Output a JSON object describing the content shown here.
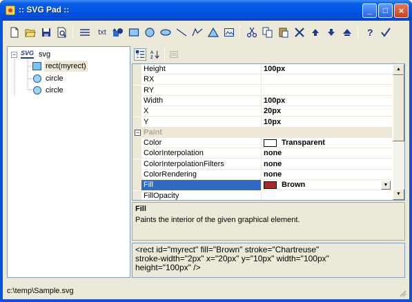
{
  "window": {
    "title": ":: SVG Pad ::",
    "controls": [
      "_",
      "□",
      "×"
    ]
  },
  "toolbar": {
    "items": [
      {
        "name": "new-document-icon"
      },
      {
        "name": "open-folder-icon"
      },
      {
        "name": "save-icon"
      },
      {
        "name": "print-preview-icon"
      },
      {
        "name": "lines-icon"
      },
      {
        "name": "text-tool",
        "label": "txt"
      },
      {
        "name": "shapes-icon"
      },
      {
        "name": "rect-tool-icon"
      },
      {
        "name": "circle-tool-icon"
      },
      {
        "name": "ellipse-tool-icon"
      },
      {
        "name": "line-tool-icon"
      },
      {
        "name": "polyline-tool-icon"
      },
      {
        "name": "polygon-tool-icon"
      },
      {
        "name": "image-tool-icon"
      },
      {
        "name": "cut-icon"
      },
      {
        "name": "copy-icon"
      },
      {
        "name": "paste-icon"
      },
      {
        "name": "delete-icon"
      },
      {
        "name": "move-up-icon"
      },
      {
        "name": "move-down-icon"
      },
      {
        "name": "move-top-icon"
      },
      {
        "name": "help-icon"
      },
      {
        "name": "check-icon"
      }
    ]
  },
  "tree": {
    "root_tag": "SVG",
    "root_label": "svg",
    "children": [
      {
        "label": "rect(myrect)",
        "kind": "rect"
      },
      {
        "label": "circle",
        "kind": "circle"
      },
      {
        "label": "circle",
        "kind": "circle"
      }
    ]
  },
  "properties": {
    "rows": [
      {
        "name": "Height",
        "value": "100px"
      },
      {
        "name": "RX",
        "value": ""
      },
      {
        "name": "RY",
        "value": ""
      },
      {
        "name": "Width",
        "value": "100px"
      },
      {
        "name": "X",
        "value": "20px"
      },
      {
        "name": "Y",
        "value": "10px"
      },
      {
        "name": "Paint",
        "value": "",
        "category": true
      },
      {
        "name": "Color",
        "value": "Transparent",
        "swatch": "#ffffff"
      },
      {
        "name": "ColorInterpolation",
        "value": "none"
      },
      {
        "name": "ColorInterpolationFilters",
        "value": "none"
      },
      {
        "name": "ColorRendering",
        "value": "none"
      },
      {
        "name": "Fill",
        "value": "Brown",
        "swatch": "#a52a2a",
        "selected": true
      },
      {
        "name": "FillOpacity",
        "value": ""
      }
    ]
  },
  "description": {
    "title": "Fill",
    "text": "Paints the interior of the given graphical element."
  },
  "code": "<rect id=\"myrect\" fill=\"Brown\" stroke=\"Chartreuse\"\nstroke-width=\"2px\" x=\"20px\" y=\"10px\" width=\"100px\"\nheight=\"100px\" />",
  "status": {
    "path": "c:\\temp\\Sample.svg"
  }
}
